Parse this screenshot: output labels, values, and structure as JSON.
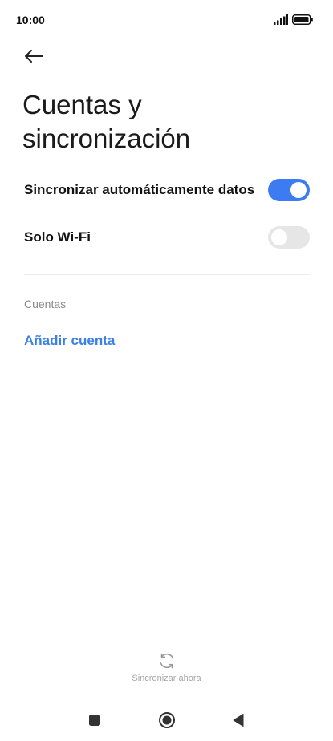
{
  "status_bar": {
    "time": "10:00",
    "signal_icon": "signal-bars-icon",
    "battery_icon": "battery-full-icon"
  },
  "header": {
    "back_icon": "arrow-left-icon",
    "title": "Cuentas y sincronización"
  },
  "settings": [
    {
      "label": "Sincronizar automáticamente datos",
      "enabled": true
    },
    {
      "label": "Solo Wi-Fi",
      "enabled": false
    }
  ],
  "accounts_section": {
    "header": "Cuentas",
    "add_account_label": "Añadir cuenta"
  },
  "footer": {
    "sync_icon": "sync-icon",
    "sync_label": "Sincronizar ahora"
  },
  "nav": {
    "recents_icon": "square-icon",
    "home_icon": "circle-icon",
    "back_icon": "triangle-back-icon"
  },
  "colors": {
    "accent": "#3c7bf2",
    "link": "#3b80e6",
    "toggle_off": "#e6e6e6"
  }
}
